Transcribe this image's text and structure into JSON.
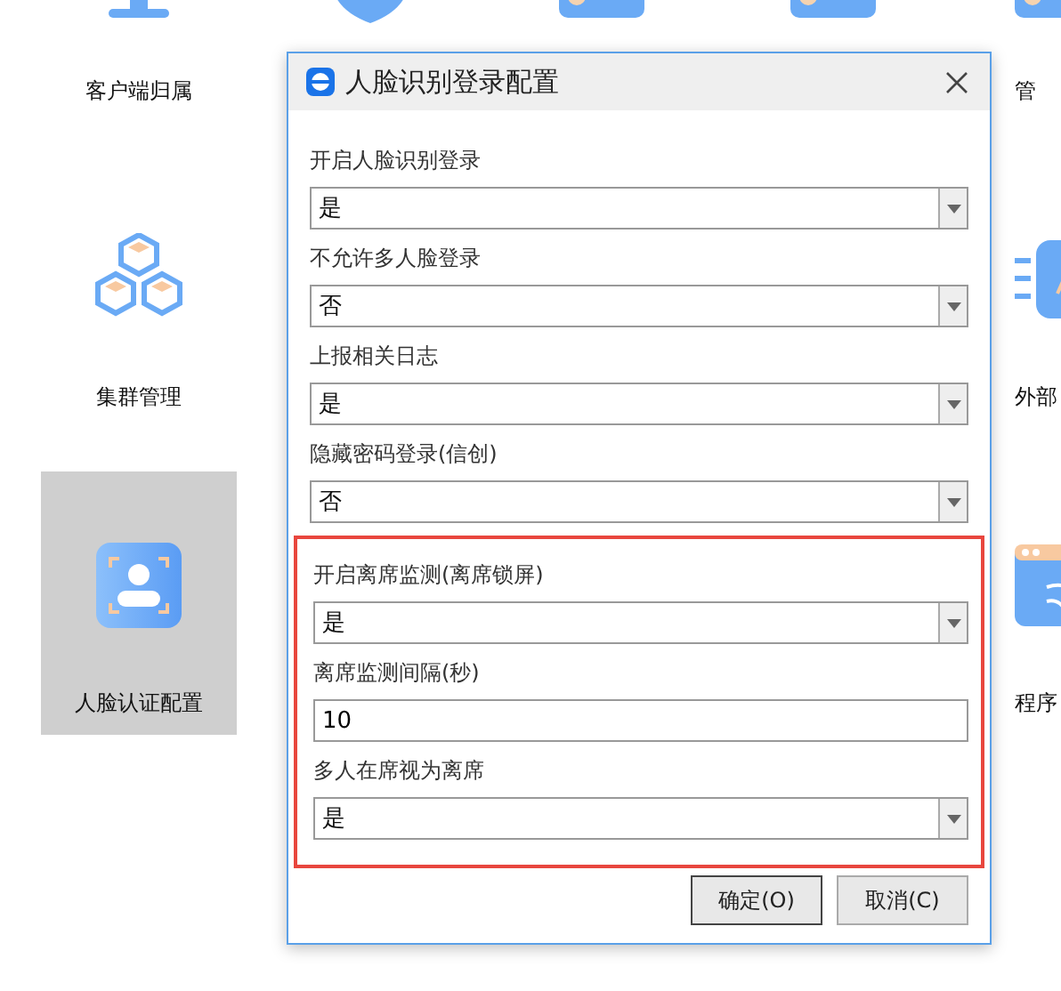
{
  "tiles": [
    {
      "label": "客户端归属",
      "selected": false
    },
    {
      "selected": false
    },
    {
      "selected": false
    },
    {
      "selected": false
    },
    {
      "label": "管",
      "selected": false
    },
    {
      "label": "集群管理",
      "selected": false
    },
    {
      "label": "外部",
      "selected": false
    },
    {
      "label": "人脸认证配置",
      "selected": true
    },
    {
      "label": "程序",
      "selected": false
    }
  ],
  "dialog": {
    "title": "人脸识别登录配置",
    "fields": [
      {
        "label": "开启人脸识别登录",
        "kind": "select",
        "value": "是"
      },
      {
        "label": "不允许多人脸登录",
        "kind": "select",
        "value": "否"
      },
      {
        "label": "上报相关日志",
        "kind": "select",
        "value": "是"
      },
      {
        "label": "隐藏密码登录(信创)",
        "kind": "select",
        "value": "否"
      }
    ],
    "highlighted_group": {
      "fields": [
        {
          "label": "开启离席监测(离席锁屏)",
          "kind": "select",
          "value": "是"
        },
        {
          "label": "离席监测间隔(秒)",
          "kind": "text",
          "value": "10"
        },
        {
          "label": "多人在席视为离席",
          "kind": "select",
          "value": "是"
        }
      ]
    },
    "buttons": [
      {
        "label": "确定(O)",
        "default": true
      },
      {
        "label": "取消(C)",
        "default": false
      }
    ]
  }
}
